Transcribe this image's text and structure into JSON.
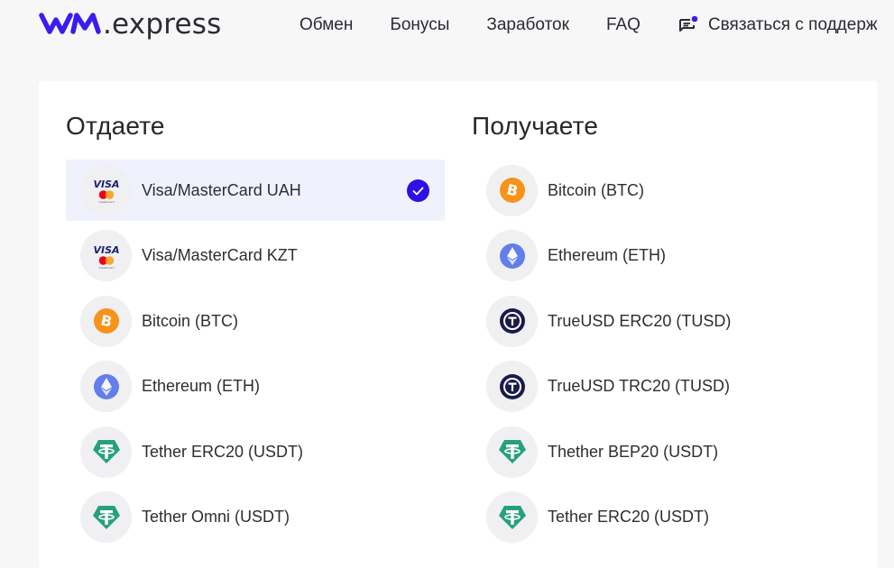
{
  "header": {
    "logo_text": ".express",
    "nav": [
      {
        "label": "Обмен"
      },
      {
        "label": "Бонусы"
      },
      {
        "label": "Заработок"
      },
      {
        "label": "FAQ"
      }
    ],
    "support_label": "Связаться с поддерж"
  },
  "give": {
    "title": "Отдаете",
    "items": [
      {
        "label": "Visa/MasterCard UAH",
        "icon": "visa-mastercard-icon",
        "selected": true
      },
      {
        "label": "Visa/MasterCard KZT",
        "icon": "visa-mastercard-icon",
        "selected": false
      },
      {
        "label": "Bitcoin (BTC)",
        "icon": "bitcoin-icon",
        "selected": false
      },
      {
        "label": "Ethereum (ETH)",
        "icon": "ethereum-icon",
        "selected": false
      },
      {
        "label": "Tether ERC20 (USDT)",
        "icon": "tether-icon",
        "selected": false
      },
      {
        "label": "Tether Omni (USDT)",
        "icon": "tether-icon",
        "selected": false
      }
    ]
  },
  "receive": {
    "title": "Получаете",
    "items": [
      {
        "label": "Bitcoin (BTC)",
        "icon": "bitcoin-icon"
      },
      {
        "label": "Ethereum (ETH)",
        "icon": "ethereum-icon"
      },
      {
        "label": "TrueUSD ERC20 (TUSD)",
        "icon": "trueusd-icon"
      },
      {
        "label": "TrueUSD TRC20 (TUSD)",
        "icon": "trueusd-icon"
      },
      {
        "label": "Thether BEP20 (USDT)",
        "icon": "tether-icon"
      },
      {
        "label": "Tether ERC20 (USDT)",
        "icon": "tether-icon"
      }
    ]
  },
  "colors": {
    "brand": "#3b1cf0",
    "selected_bg": "#eff2fd",
    "check": "#2e10e6",
    "bitcoin": "#f7931a",
    "ethereum": "#627eea",
    "tether": "#26a17b",
    "trueusd": "#1a1b4b"
  }
}
